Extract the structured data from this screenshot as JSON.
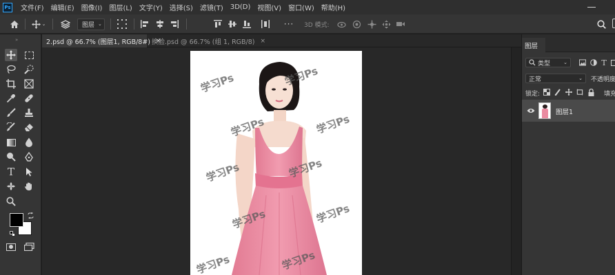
{
  "app": {
    "logo_text": "Ps"
  },
  "menu": [
    "文件(F)",
    "编辑(E)",
    "图像(I)",
    "图层(L)",
    "文字(Y)",
    "选择(S)",
    "滤镜(T)",
    "3D(D)",
    "视图(V)",
    "窗口(W)",
    "帮助(H)"
  ],
  "options": {
    "home_icon": "home-icon",
    "layer_select_label": "图层",
    "mode_3d_label": "3D 模式:"
  },
  "tabs": [
    {
      "label": "2.psd @ 66.7% (图层1, RGB/8#)",
      "close": "×",
      "active": true
    },
    {
      "label": "换脸.psd @ 66.7% (组 1, RGB/8)",
      "close": "×",
      "active": false
    }
  ],
  "watermarks": [
    "学习Ps",
    "学习Ps",
    "学习Ps",
    "学习Ps",
    "学习Ps",
    "学习Ps",
    "学习Ps",
    "学习Ps",
    "学习Ps",
    "学习Ps"
  ],
  "layers_panel": {
    "tab_label": "图层",
    "filter_label": "类型",
    "blend_mode": "正常",
    "opacity_label": "不透明度",
    "lock_label": "锁定:",
    "fill_label": "填充",
    "layers": [
      {
        "name": "图层1",
        "visible": true
      }
    ]
  },
  "colors": {
    "foreground": "#000000",
    "background": "#ffffff",
    "accent": "#31a8ff",
    "dress": "#ea8ba1"
  }
}
